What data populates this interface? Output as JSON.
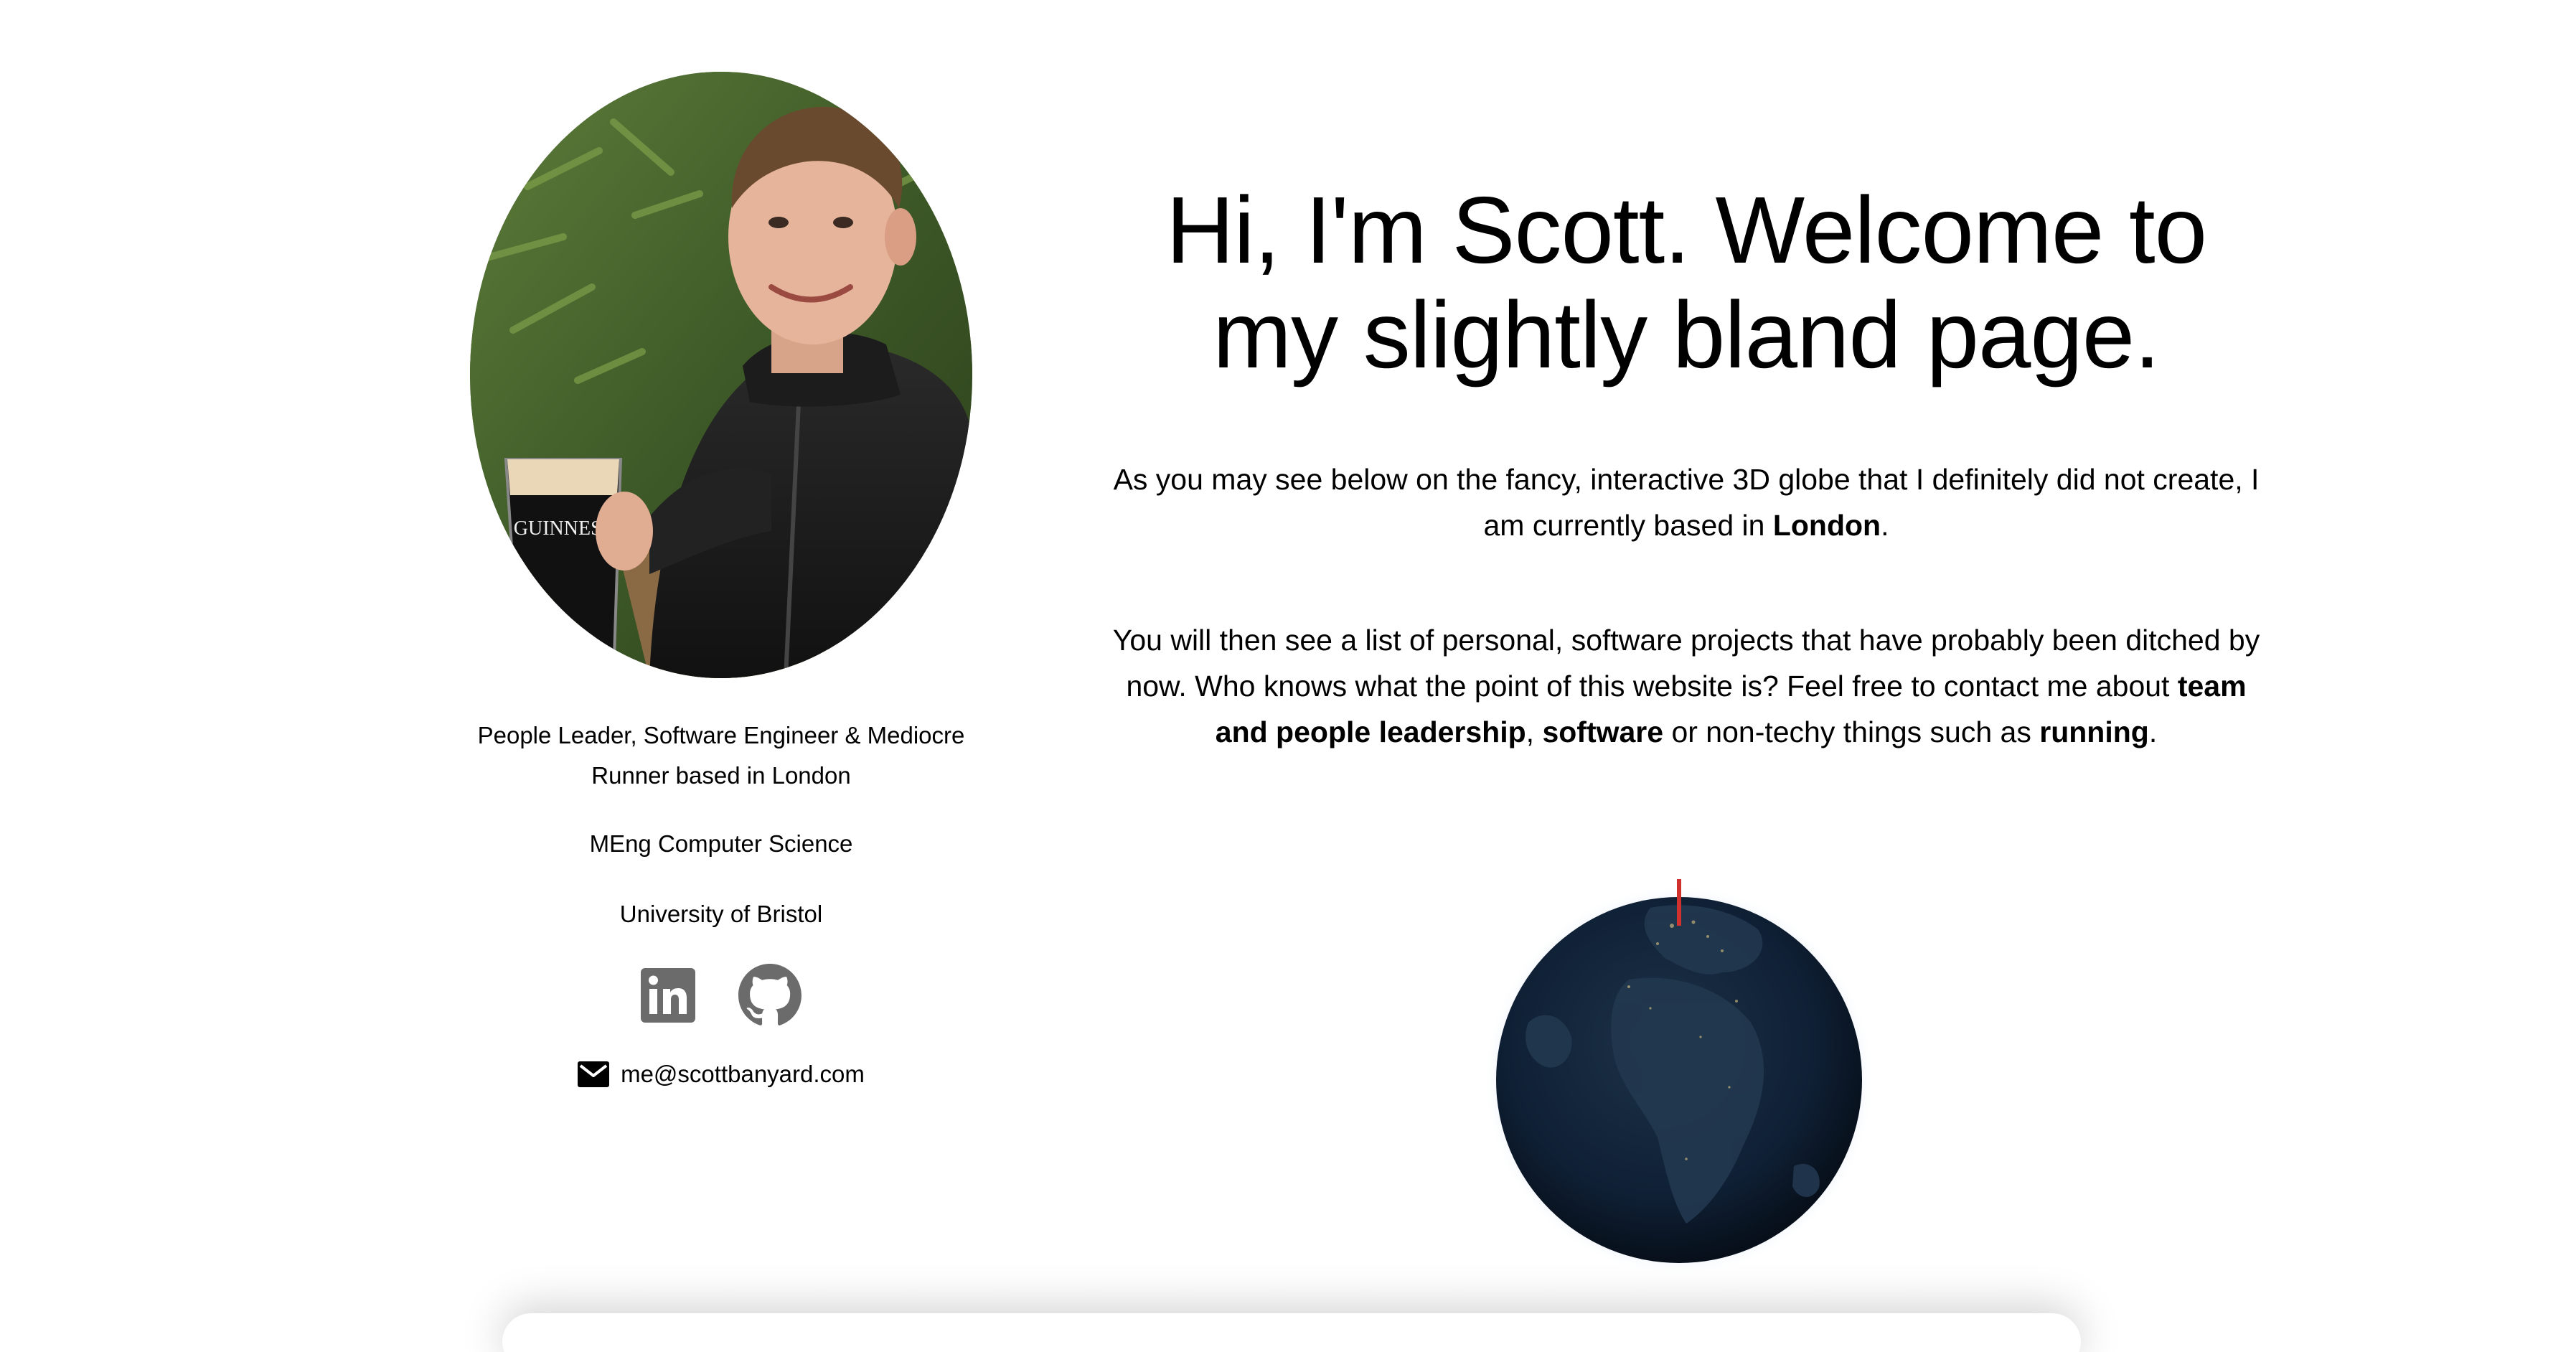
{
  "profile": {
    "avatar_alt": "Profile photo",
    "tagline": "People Leader, Software Engineer & Mediocre Runner based in London",
    "degree": "MEng Computer Science",
    "university": "University of Bristol",
    "socials": [
      {
        "name": "linkedin",
        "icon": "linkedin-icon"
      },
      {
        "name": "github",
        "icon": "github-icon"
      }
    ],
    "email": "me@scottbanyard.com"
  },
  "main": {
    "headline": "Hi, I'm Scott. Welcome to my slightly bland page.",
    "para1": {
      "text": "As you may see below on the fancy, interactive 3D globe that I definitely did not create, I am currently based in ",
      "bold": "London",
      "end": "."
    },
    "para2": {
      "t1": "You will then see a list of personal, software projects that have probably been ditched by now. Who knows what the point of this website is? Feel free to contact me about ",
      "b1": "team and people leadership",
      "t2": ", ",
      "b2": "software",
      "t3": " or non-techy things such as ",
      "b3": "running",
      "t4": "."
    }
  },
  "colors": {
    "globe_dark": "#0d1a2b",
    "marker": "#d0312d",
    "icon_gray": "#6b6b6b"
  }
}
